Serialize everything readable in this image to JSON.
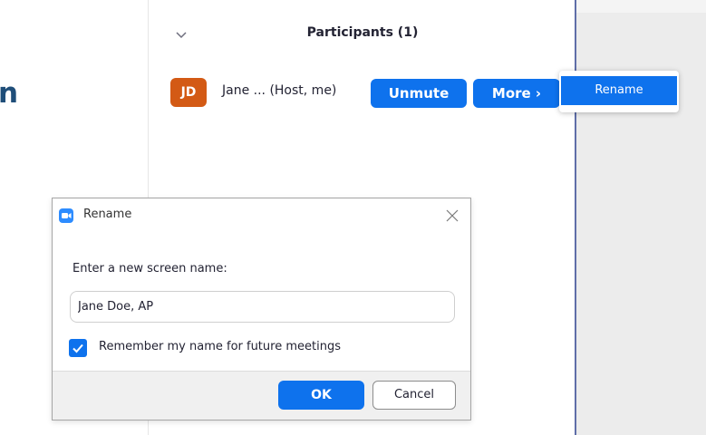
{
  "background_heading": {
    "fragment": "n"
  },
  "participants_panel": {
    "title": "Participants (1)",
    "collapse_icon": "chevron-down-icon",
    "participant": {
      "initials": "JD",
      "avatar_color": "#d35a15",
      "name": "Jane ... (Host, me)",
      "unmute_label": "Unmute",
      "more_label": "More ›"
    }
  },
  "context_menu": {
    "items": [
      {
        "label": "Rename"
      }
    ]
  },
  "rename_dialog": {
    "title": "Rename",
    "logo_icon": "zoom-logo-icon",
    "close_icon": "close-icon",
    "prompt_label": "Enter a new screen name:",
    "screen_name_value": "Jane Doe, AP",
    "remember_checked": true,
    "remember_label": "Remember my name for future meetings",
    "ok_label": "OK",
    "cancel_label": "Cancel"
  },
  "colors": {
    "accent_blue": "#0e72ed",
    "heading_blue": "#1f4e79",
    "text_dark": "#232333"
  }
}
